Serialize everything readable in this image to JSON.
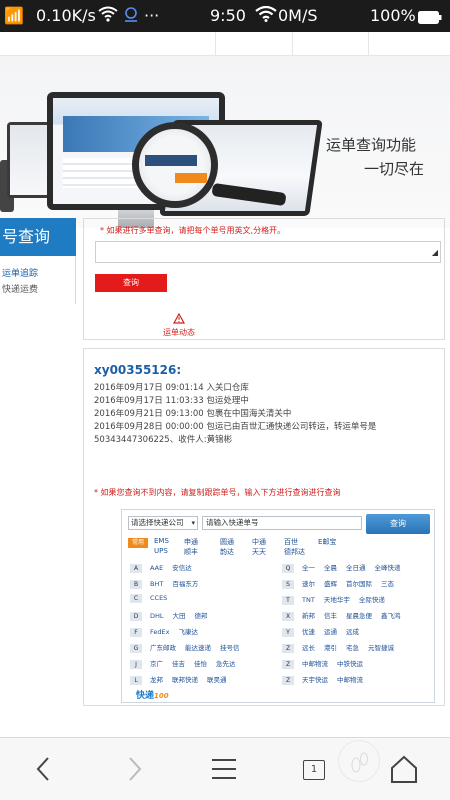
{
  "status_bar": {
    "signal": "📶",
    "net_speed": "0.10K/s",
    "time": "9:50",
    "speed": "0M/S",
    "battery": "100%"
  },
  "banner": {
    "title": "运单查询功能",
    "subtitle": "一切尽在"
  },
  "left_menu": {
    "title": "号查询",
    "items": [
      "运单追踪",
      "快递运费"
    ]
  },
  "query": {
    "hint": "* 如果进行多单查询，请把每个单号用英文,分格开。",
    "button": "查询",
    "section_label": "运单动态",
    "resize_glyph": "◢"
  },
  "result": {
    "tracking_no": "xy00355126:",
    "lines": [
      "2016年09月17日 09:01:14 入关口仓库",
      "2016年09月17日 11:03:33 包运处理中",
      "2016年09月21日 09:13:00 包裹在中国海关清关中",
      "2016年09月28日 00:00:00 包运已由百世汇通快递公司转运，转运单号是",
      "50343447306225、收件人:黄锦彬"
    ],
    "hint": "* 如果您查询不到内容，请复制跟踪单号，输入下方进行查询进行查询"
  },
  "widget": {
    "select_value": "请选择快递公司",
    "input_value": "请输入快递单号",
    "search_button": "查询",
    "common_tag": "常用",
    "common_row1": [
      "EMS",
      "申通",
      "圆通",
      "中通",
      "百世",
      "E邮宝"
    ],
    "common_row2": [
      "UPS",
      "顺丰",
      "韵达",
      "天天",
      "德邦达"
    ],
    "left_rows": [
      {
        "letter": "A",
        "companies": [
          "AAE",
          "安信达"
        ]
      },
      {
        "letter": "B",
        "companies": [
          "BHT",
          "百福东方"
        ]
      },
      {
        "letter": "C",
        "companies": [
          "CCES"
        ]
      },
      {
        "letter": "D",
        "companies": [
          "DHL",
          "大田",
          "德邦"
        ]
      },
      {
        "letter": "F",
        "companies": [
          "FedEx",
          "飞康达"
        ]
      },
      {
        "letter": "G",
        "companies": [
          "广东邮政",
          "能达速递",
          "挂号信"
        ]
      },
      {
        "letter": "J",
        "companies": [
          "京广",
          "佳吉",
          "佳怡",
          "急先达"
        ]
      },
      {
        "letter": "L",
        "companies": [
          "龙邦",
          "联邦快递",
          "联昊通"
        ]
      }
    ],
    "right_rows": [
      {
        "letter": "Q",
        "companies": [
          "全一",
          "全晨",
          "全日通",
          "全峰快递"
        ]
      },
      {
        "letter": "S",
        "companies": [
          "速尔",
          "盛辉",
          "首尔国际",
          "三态"
        ]
      },
      {
        "letter": "T",
        "companies": [
          "TNT",
          "天地华宇",
          "全际快递"
        ]
      },
      {
        "letter": "X",
        "companies": [
          "新邦",
          "信丰",
          "星晨急便",
          "鑫飞鸿"
        ]
      },
      {
        "letter": "Y",
        "companies": [
          "优速",
          "运通",
          "远成"
        ]
      },
      {
        "letter": "Z",
        "companies": [
          "远长",
          "港引",
          "宅急",
          "元智捷诚"
        ]
      },
      {
        "letter": "Z",
        "companies": [
          "中邮物流",
          "中铁快运"
        ]
      },
      {
        "letter": "Z",
        "companies": [
          "天宇快运",
          "中邮物流"
        ]
      }
    ],
    "brand": "快递",
    "brand_suffix": "100"
  },
  "nav": {
    "tab_count": "1"
  }
}
